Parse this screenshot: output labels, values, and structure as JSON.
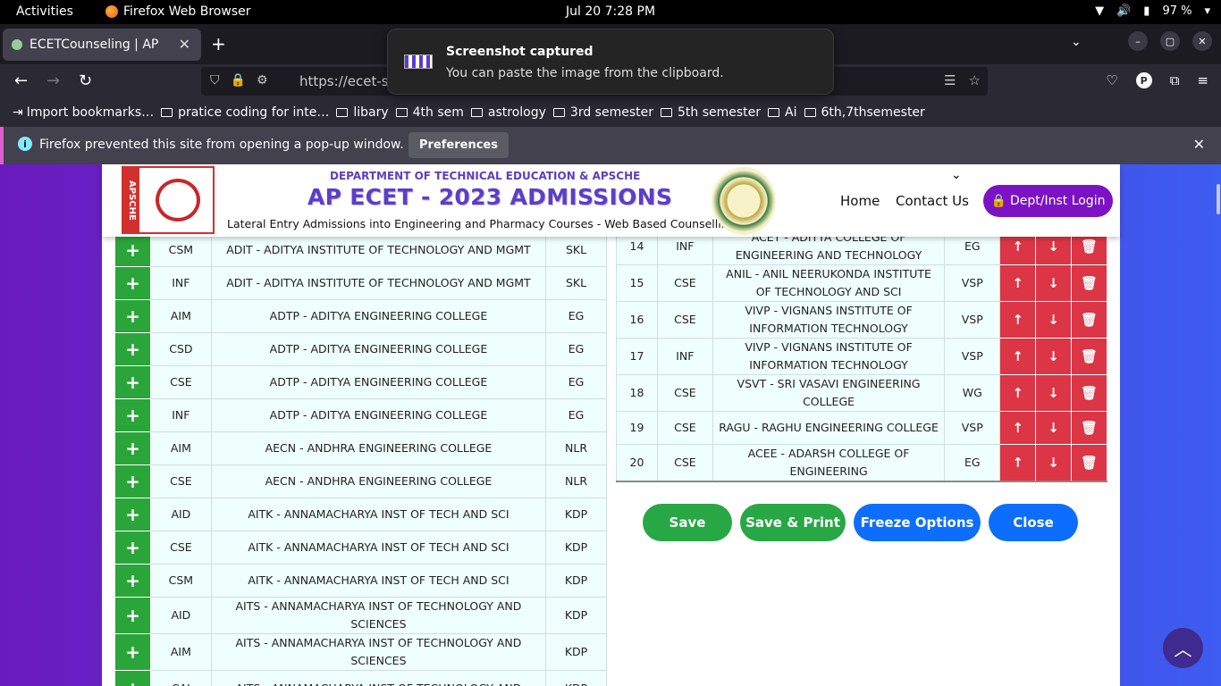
{
  "system_bar": {
    "activities": "Activities",
    "app_name": "Firefox Web Browser",
    "clock": "Jul 20  7:28 PM",
    "battery": "97 %"
  },
  "browser": {
    "tab_title": "ECETCounseling | AP",
    "url": "https://ecet-sc",
    "bookmarks": [
      "Import bookmarks…",
      "pratice coding for inte…",
      "libary",
      "4th sem",
      "astrology",
      "3rd semester",
      "5th semester",
      "Ai",
      "6th,7thsemester"
    ],
    "notification": {
      "message": "Firefox prevented this site from opening a pop-up window.",
      "button": "Preferences"
    }
  },
  "toast": {
    "title": "Screenshot captured",
    "body": "You can paste the image from the clipboard."
  },
  "site": {
    "logo_left_strip": "APSCHE",
    "department": "DEPARTMENT OF TECHNICAL EDUCATION & APSCHE",
    "title": "AP ECET - 2023 ADMISSIONS",
    "subtitle": "Lateral Entry Admissions  into Engineering and Pharmacy Courses - Web Based Counselling",
    "nav_home": "Home",
    "nav_contact": "Contact Us",
    "login": "Dept/Inst Login"
  },
  "available_options": [
    {
      "branch": "CSM",
      "college": "ADIT - ADITYA INSTITUTE OF TECHNOLOGY AND MGMT",
      "district": "SKL"
    },
    {
      "branch": "INF",
      "college": "ADIT - ADITYA INSTITUTE OF TECHNOLOGY AND MGMT",
      "district": "SKL"
    },
    {
      "branch": "AIM",
      "college": "ADTP - ADITYA ENGINEERING COLLEGE",
      "district": "EG"
    },
    {
      "branch": "CSD",
      "college": "ADTP - ADITYA ENGINEERING COLLEGE",
      "district": "EG"
    },
    {
      "branch": "CSE",
      "college": "ADTP - ADITYA ENGINEERING COLLEGE",
      "district": "EG"
    },
    {
      "branch": "INF",
      "college": "ADTP - ADITYA ENGINEERING COLLEGE",
      "district": "EG"
    },
    {
      "branch": "AIM",
      "college": "AECN - ANDHRA ENGINEERING COLLEGE",
      "district": "NLR"
    },
    {
      "branch": "CSE",
      "college": "AECN - ANDHRA ENGINEERING COLLEGE",
      "district": "NLR"
    },
    {
      "branch": "AID",
      "college": "AITK - ANNAMACHARYA INST OF TECH AND SCI",
      "district": "KDP"
    },
    {
      "branch": "CSE",
      "college": "AITK - ANNAMACHARYA INST OF TECH AND SCI",
      "district": "KDP"
    },
    {
      "branch": "CSM",
      "college": "AITK - ANNAMACHARYA INST OF TECH AND SCI",
      "district": "KDP"
    },
    {
      "branch": "AID",
      "college": "AITS - ANNAMACHARYA INST OF TECHNOLOGY AND SCIENCES",
      "district": "KDP"
    },
    {
      "branch": "AIM",
      "college": "AITS - ANNAMACHARYA INST OF TECHNOLOGY AND SCIENCES",
      "district": "KDP"
    },
    {
      "branch": "CAI",
      "college": "AITS - ANNAMACHARYA INST OF TECHNOLOGY AND",
      "district": "KDP"
    }
  ],
  "selected_options": [
    {
      "sno": "14",
      "branch": "INF",
      "college": "ACET - ADITYA COLLEGE OF ENGINEERING AND TECHNOLOGY",
      "district": "EG"
    },
    {
      "sno": "15",
      "branch": "CSE",
      "college": "ANIL - ANIL NEERUKONDA INSTITUTE OF TECHNOLOGY AND SCI",
      "district": "VSP"
    },
    {
      "sno": "16",
      "branch": "CSE",
      "college": "VIVP - VIGNANS INSTITUTE OF INFORMATION TECHNOLOGY",
      "district": "VSP"
    },
    {
      "sno": "17",
      "branch": "INF",
      "college": "VIVP - VIGNANS INSTITUTE OF INFORMATION TECHNOLOGY",
      "district": "VSP"
    },
    {
      "sno": "18",
      "branch": "CSE",
      "college": "VSVT - SRI VASAVI ENGINEERING COLLEGE",
      "district": "WG"
    },
    {
      "sno": "19",
      "branch": "CSE",
      "college": "RAGU - RAGHU ENGINEERING COLLEGE",
      "district": "VSP"
    },
    {
      "sno": "20",
      "branch": "CSE",
      "college": "ACEE - ADARSH COLLEGE OF ENGINEERING",
      "district": "EG"
    }
  ],
  "actions": {
    "save": "Save",
    "save_print": "Save & Print",
    "freeze": "Freeze Options",
    "close": "Close"
  }
}
